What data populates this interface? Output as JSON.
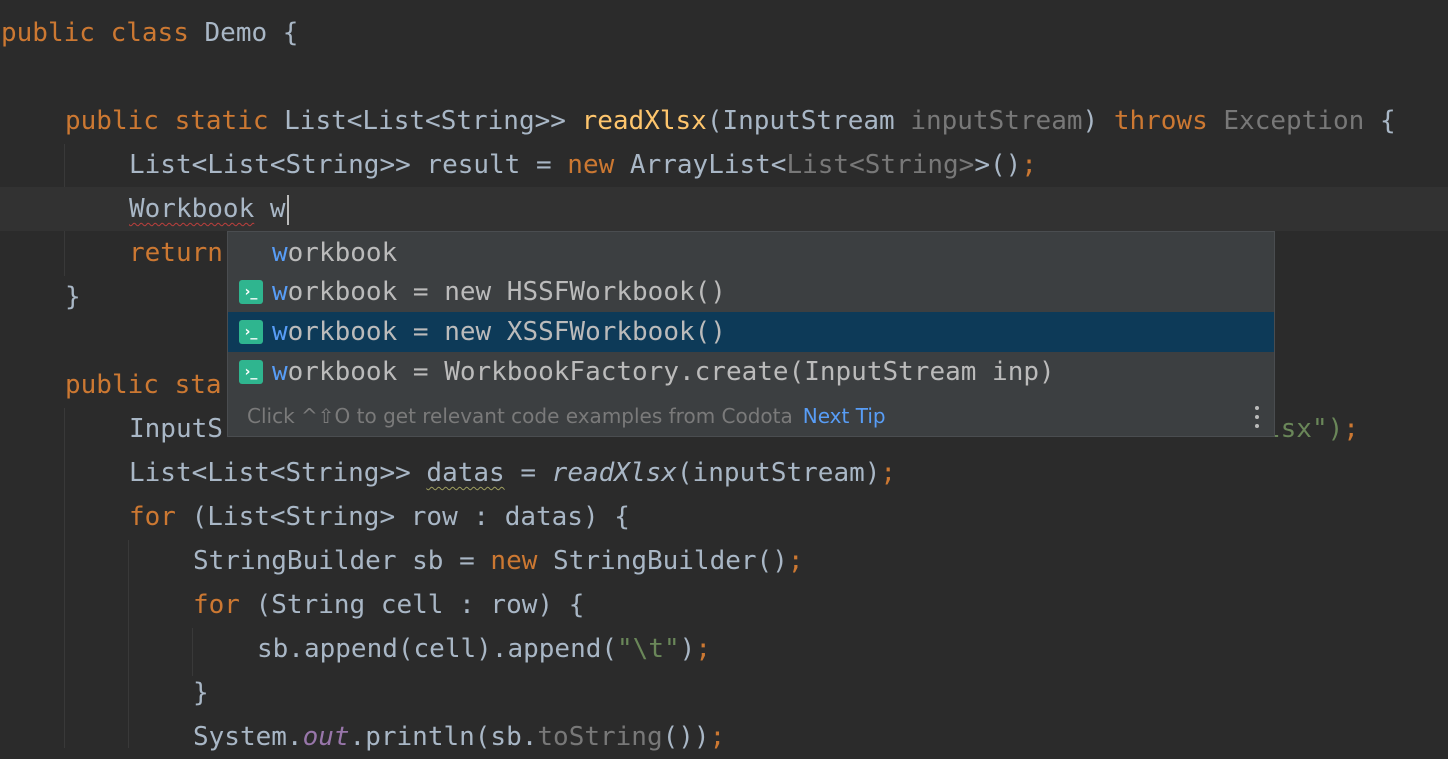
{
  "editor": {
    "lines": [
      {
        "t1": "public",
        "t2": "class",
        "t3": "Demo {"
      },
      {
        "t1": "public",
        "t2": "static",
        "t3": "List<List<String>>",
        "t4": "readXlsx",
        "t5": "(InputStream",
        "t6": "inputStream",
        "t7": ")",
        "t8": "throws",
        "t9": "Exception",
        "t10": "{"
      },
      {
        "t1": "List<List<String>> result = ",
        "t2": "new",
        "t3": "ArrayList<",
        "t4": "List<String>",
        "t5": ">()",
        "t6": ";"
      },
      {
        "t1": "Workbook",
        "t2": "w"
      },
      {
        "t1": "return"
      },
      {
        "t1": "}"
      },
      {
        "t1": "public",
        "t2": "sta"
      },
      {
        "t1": "InputS",
        "t2": "lsx\")",
        "t3": ";"
      },
      {
        "t1": "List<List<String>> ",
        "t2": "datas",
        "t3": " = ",
        "t4": "readXlsx",
        "t5": "(inputStream)",
        "t6": ";"
      },
      {
        "t1": "for",
        "t2": "(List<String> row : datas) {"
      },
      {
        "t1": "StringBuilder sb = ",
        "t2": "new",
        "t3": "StringBuilder()",
        "t4": ";"
      },
      {
        "t1": "for",
        "t2": "(String cell : row) {"
      },
      {
        "t1": "sb.append(cell).append(",
        "t2": "\"\\t\"",
        "t3": ")",
        "t4": ";"
      },
      {
        "t1": "}"
      },
      {
        "t1": "System.",
        "t2": "out",
        "t3": ".println(sb.",
        "t4": "toString",
        "t5": "())",
        "t6": ";"
      }
    ]
  },
  "completion": {
    "items": [
      {
        "match": "w",
        "rest": "orkbook",
        "icon": ""
      },
      {
        "match": "w",
        "rest": "orkbook = new HSSFWorkbook()",
        "icon": "template-icon"
      },
      {
        "match": "w",
        "rest": "orkbook = new XSSFWorkbook()",
        "icon": "template-icon"
      },
      {
        "match": "w",
        "rest": "orkbook = WorkbookFactory.create(InputStream inp)",
        "icon": "template-icon"
      }
    ],
    "icon_glyph": "›_",
    "footer_tip": "Click ^⇧O to get relevant code examples from Codota",
    "footer_link": "Next Tip"
  },
  "colors": {
    "background": "#2b2b2b",
    "keyword": "#cc7832",
    "method": "#ffc66d",
    "string": "#6a8759",
    "popup_background": "#3c3f41",
    "popup_selected": "#0d3a58",
    "match": "#589df6",
    "template_icon": "#2fb58f"
  }
}
